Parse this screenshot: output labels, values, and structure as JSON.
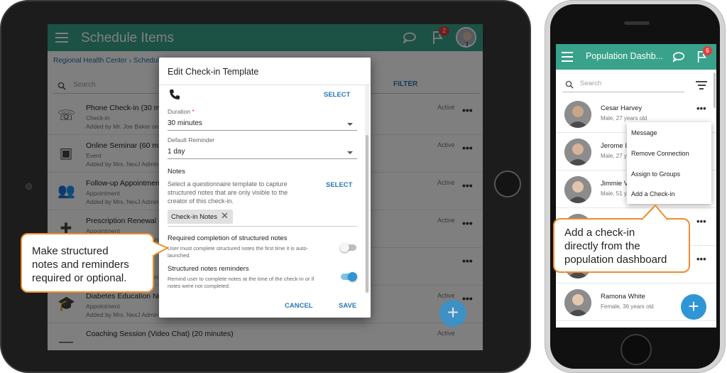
{
  "tablet": {
    "app_title": "Schedule Items",
    "notification_count": "2",
    "breadcrumb": "Regional Health Center › Schedule",
    "search_placeholder": "Search",
    "filter_label": "FILTER",
    "items": [
      {
        "icon": "phone-icon",
        "title": "Phone Check-in (30 minutes",
        "type": "Check-in",
        "added": "Added by Mr. Joe Baker on S",
        "status": "Active"
      },
      {
        "icon": "seminar-icon",
        "title": "Online Seminar (60 minu",
        "type": "Event",
        "added": "Added by Mrs. NexJ Admin",
        "status": "Active"
      },
      {
        "icon": "group-icon",
        "title": "Follow-up Appointment",
        "type": "Appointment",
        "added": "Added by Mrs. NexJ Admin",
        "status": "Active"
      },
      {
        "icon": "medical-kit-icon",
        "title": "Prescription Renewal (1",
        "type": "Appointment",
        "added": "Added by Mrs. NexJ Admin",
        "status": "Active"
      },
      {
        "icon": "calendar-icon",
        "title": "",
        "type": "Appointment",
        "added": "Added by Mrs. NexJ Admin",
        "status": ""
      },
      {
        "icon": "graduation-cap-icon",
        "title": "Diabetes Education Nut",
        "type": "Appointment",
        "added": "Added by Mrs. NexJ Admin",
        "status": "Active"
      },
      {
        "icon": "minus-icon",
        "title": "Coaching Session (Video Chat) (20 minutes)",
        "type": "",
        "added": "",
        "status": "Active"
      }
    ],
    "dialog": {
      "title": "Edit Check-in Template",
      "select_label": "SELECT",
      "duration_label": "Duration",
      "duration_value": "30 minutes",
      "reminder_label": "Default Reminder",
      "reminder_value": "1 day",
      "notes_heading": "Notes",
      "notes_desc_1": "Select a questionnaire template to capture",
      "notes_desc_2": "structured notes that are only visible to the",
      "notes_desc_3": "creator of this check-in.",
      "notes_select_label": "SELECT",
      "chip_label": "Check-in Notes",
      "required_title": "Required completion of structured notes",
      "required_desc_1": "User must complete structured notes the first time it is auto-",
      "required_desc_2": "launched.",
      "required_on": false,
      "reminders_title": "Structured notes reminders",
      "reminders_desc_1": "Remind user to complete notes at the time of the check-in or if",
      "reminders_desc_2": "notes were not completed.",
      "reminders_on": true,
      "cancel_label": "CANCEL",
      "save_label": "SAVE"
    },
    "callout_1": "Make structured",
    "callout_2": "notes and reminders",
    "callout_3": "required or optional."
  },
  "phone": {
    "app_title": "Population Dashb...",
    "notification_count": "6",
    "search_placeholder": "Search",
    "people": [
      {
        "name": "Cesar Harvey",
        "sub": "Male, 27 years old"
      },
      {
        "name": "Jerome I",
        "sub": "Male, 27 ye"
      },
      {
        "name": "Jimmie V",
        "sub": "Male, 51 y"
      },
      {
        "name": "",
        "sub": ""
      },
      {
        "name": "",
        "sub": ""
      },
      {
        "name": "Ramona White",
        "sub": "Female, 36 years old"
      }
    ],
    "menu": [
      "Message",
      "Remove Connection",
      "Assign to Groups",
      "Add a Check-in"
    ],
    "callout_1": "Add a check-in",
    "callout_2": "directly from the",
    "callout_3": "population dashboard"
  },
  "colors": {
    "primary": "#39a28b",
    "accent": "#2e96d6",
    "callout_border": "#f08c2a",
    "badge": "#e53935"
  }
}
